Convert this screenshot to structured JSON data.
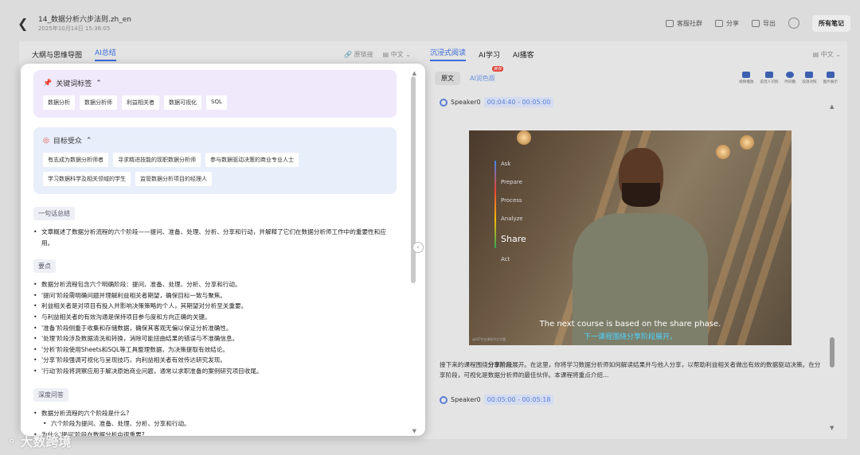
{
  "header": {
    "title": "14_数据分析六步法则.zh_en",
    "datetime": "2025年10月14日 15:36:05",
    "actions": [
      "客服社群",
      "分享",
      "导出"
    ],
    "all_notes": "所有笔记"
  },
  "left_tabs": {
    "tab1": "大纲与思维导图",
    "tab2": "AI总结",
    "original_link": "原链接",
    "lang": "中文"
  },
  "keywords": {
    "title": "关键词标签",
    "tags": [
      "数据分析",
      "数据分析师",
      "利益相关者",
      "数据可视化",
      "SQL"
    ]
  },
  "audience": {
    "title": "目标受众",
    "tags": [
      "有志成为数据分析师者",
      "寻求精进技能的现职数据分析师",
      "参与数据驱动决策的商业专业人士",
      "学习数据科学及相关领域的学生",
      "监管数据分析项目的经理人"
    ]
  },
  "summary": {
    "label": "一句话总结",
    "text": "文章概述了数据分析流程的六个阶段——提问、准备、处理、分析、分享和行动，并解释了它们在数据分析师工作中的重要性和应用。"
  },
  "key_points": {
    "label": "要点",
    "items": [
      "数据分析流程包含六个明确阶段：提问、准备、处理、分析、分享和行动。",
      "'提问'阶段需明确问题并理解利益相关者期望，确保目标一致与聚焦。",
      "利益相关者是对项目有投入并影响决策策略的个人，其期望对分析至关重要。",
      "与利益相关者的有效沟通是保持项目参与度和方向正确的关键。",
      "'准备'阶段侧重于收集和存储数据，确保其客观无偏以保证分析准确性。",
      "'处理'阶段涉及数据清洗和转换，消除可能扭曲结果的错误与不准确信息。",
      "'分析'阶段使用Sheets和SQL等工具整理数据，为决策提取有效结论。",
      "'分享'阶段强调可视化与呈现技巧，向利益相关者有效传达研究发现。",
      "'行动'阶段将洞察应用于解决原始商业问题，通常以求职准备的案例研究项目收尾。"
    ]
  },
  "qa": {
    "label": "深度问答",
    "q1": "数据分析流程的六个阶段是什么?",
    "a1": "六个阶段为提问、准备、处理、分析、分享和行动。",
    "q2": "为什么'提问'阶段在数据分析中很重要?"
  },
  "right_tabs": {
    "tab1": "沉浸式阅读",
    "tab2": "AI学习",
    "tab3": "AI播客",
    "lang": "中文"
  },
  "view_toggle": {
    "original": "原文",
    "ai_polish": "AI润色版",
    "badge": "推荐"
  },
  "tools": [
    "视频播放",
    "说话人识别",
    "时间戳",
    "双语对照",
    "图片展示"
  ],
  "segment1": {
    "speaker": "Speaker0",
    "time": "00:04:40 - 00:05:00"
  },
  "video": {
    "steps": [
      "Ask",
      "Prepare",
      "Process",
      "Analyze",
      "Share",
      "Act"
    ],
    "subtitle_en": "The next course is based on the share phase.",
    "subtitle_zh": "下一课程围绕分享阶段展开。",
    "watermark": "@SIT专业课程中文字幕"
  },
  "transcript": {
    "prefix": "接下来的课程围绕",
    "bold": "分享阶段",
    "rest": "展开。在这里，你将学习数据分析师如何解读结果并与他人分享，以帮助利益相关者做出有效的数据驱动决策。在分享阶段，可视化是数据分析师的最佳伙伴。本课程将重点介绍..."
  },
  "segment2": {
    "speaker": "Speaker0",
    "time": "00:05:00 - 00:05:18"
  },
  "brand": {
    "logo_text": "大数跨境"
  }
}
